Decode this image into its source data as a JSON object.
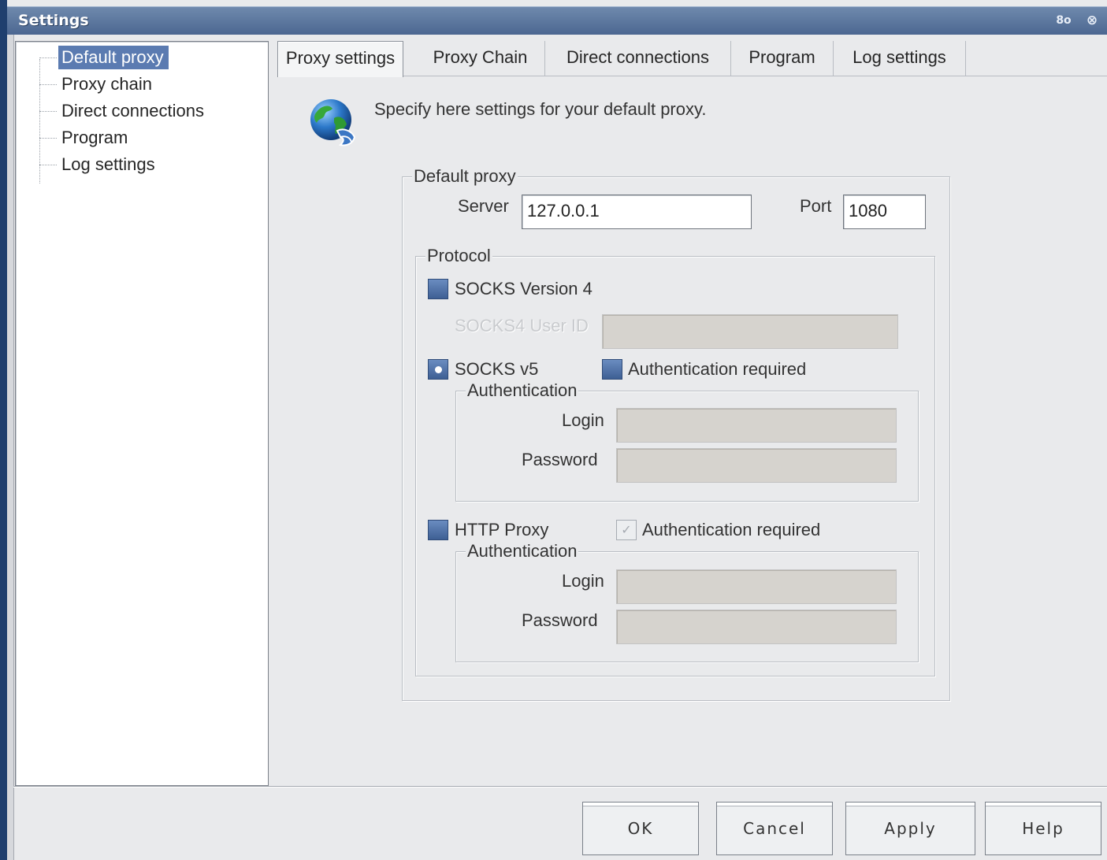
{
  "window": {
    "title": "Settings",
    "buttons": {
      "restore_glyph": "8o",
      "close_glyph": "⊗"
    }
  },
  "tree": {
    "items": [
      {
        "label": "Default proxy",
        "selected": true
      },
      {
        "label": "Proxy chain"
      },
      {
        "label": "Direct connections"
      },
      {
        "label": "Program"
      },
      {
        "label": "Log settings"
      }
    ]
  },
  "tabs": [
    {
      "label": "Proxy settings",
      "active": true
    },
    {
      "label": "Proxy Chain"
    },
    {
      "label": "Direct connections"
    },
    {
      "label": "Program"
    },
    {
      "label": "Log settings"
    }
  ],
  "info": {
    "text": "Specify here settings for your default proxy."
  },
  "default_proxy": {
    "title": "Default proxy",
    "server_label": "Server",
    "server_value": "127.0.0.1",
    "port_label": "Port",
    "port_value": "1080"
  },
  "protocol": {
    "title": "Protocol",
    "socks4": {
      "label": "SOCKS Version 4",
      "userid_label": "SOCKS4 User ID",
      "userid_value": ""
    },
    "socks5": {
      "label": "SOCKS v5",
      "auth_required_label": "Authentication required",
      "auth_title": "Authentication",
      "login_label": "Login",
      "password_label": "Password"
    },
    "http": {
      "label": "HTTP Proxy",
      "auth_required_label": "Authentication required",
      "auth_title": "Authentication",
      "login_label": "Login",
      "password_label": "Password"
    }
  },
  "buttons": {
    "ok": "OK",
    "cancel": "Cancel",
    "apply": "Apply",
    "help": "Help"
  },
  "colors": {
    "title_bar": "#4b6690",
    "selection": "#5b7bb1",
    "radio": "#3e5f94",
    "disabled_field": "#d6d3ce"
  },
  "icons": {
    "info": "globe-network-icon"
  }
}
